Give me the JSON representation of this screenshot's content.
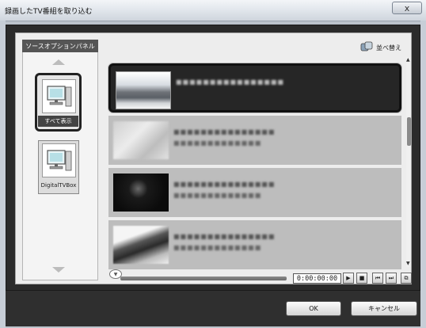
{
  "window": {
    "title": "録画したTV番組を取り込む",
    "close_glyph": "x"
  },
  "sidebar": {
    "header": "ソースオプションパネル",
    "sources": [
      {
        "label": "すべて表示",
        "icon": "computer-icon",
        "selected": true
      },
      {
        "label": "DigitalTVBox",
        "icon": "computer-icon",
        "selected": false
      }
    ]
  },
  "toolbar": {
    "sort_label": "並べ替え",
    "sort_icon": "sort-icon"
  },
  "recordings": {
    "items": [
      {
        "thumb": "landscape",
        "selected": true
      },
      {
        "thumb": "blurred-light",
        "selected": false
      },
      {
        "thumb": "dark",
        "selected": false
      },
      {
        "thumb": "mixed",
        "selected": false
      }
    ]
  },
  "player": {
    "time": "0:00:00:00",
    "buttons": [
      "play-icon",
      "stop-icon",
      "skip-back-icon",
      "skip-forward-icon",
      "snapshot-icon"
    ]
  },
  "footer": {
    "ok_label": "OK",
    "cancel_label": "キャンセル"
  }
}
